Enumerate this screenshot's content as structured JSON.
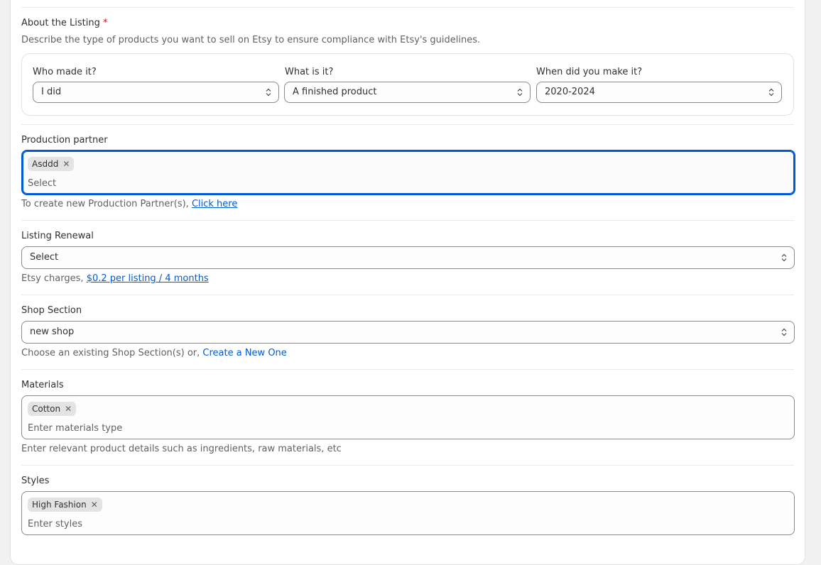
{
  "about": {
    "title": "About the Listing",
    "required_mark": "*",
    "description": "Describe the type of products you want to sell on Etsy to ensure compliance with Etsy's guidelines.",
    "who_made": {
      "label": "Who made it?",
      "value": "I did"
    },
    "what_is": {
      "label": "What is it?",
      "value": "A finished product"
    },
    "when_made": {
      "label": "When did you make it?",
      "value": "2020-2024"
    }
  },
  "production_partner": {
    "label": "Production partner",
    "tags": [
      "Asddd"
    ],
    "placeholder": "Select",
    "help_prefix": "To create new Production Partner(s),",
    "help_link": "Click here"
  },
  "listing_renewal": {
    "label": "Listing Renewal",
    "value": "Select",
    "help_prefix": "Etsy charges,",
    "help_link": "$0.2 per listing / 4 months"
  },
  "shop_section": {
    "label": "Shop Section",
    "value": "new shop",
    "help_prefix": "Choose an existing Shop Section(s) or,",
    "help_link": "Create a New One"
  },
  "materials": {
    "label": "Materials",
    "tags": [
      "Cotton"
    ],
    "placeholder": "Enter materials type",
    "help": "Enter relevant product details such as ingredients, raw materials, etc"
  },
  "styles": {
    "label": "Styles",
    "tags": [
      "High Fashion"
    ],
    "placeholder": "Enter styles"
  },
  "icons": {
    "select_chevron": "chevron-up-down-icon",
    "tag_remove": "close-icon"
  },
  "colors": {
    "accent": "#005bd3",
    "required": "#c70a24",
    "border": "#8a8a8a"
  }
}
